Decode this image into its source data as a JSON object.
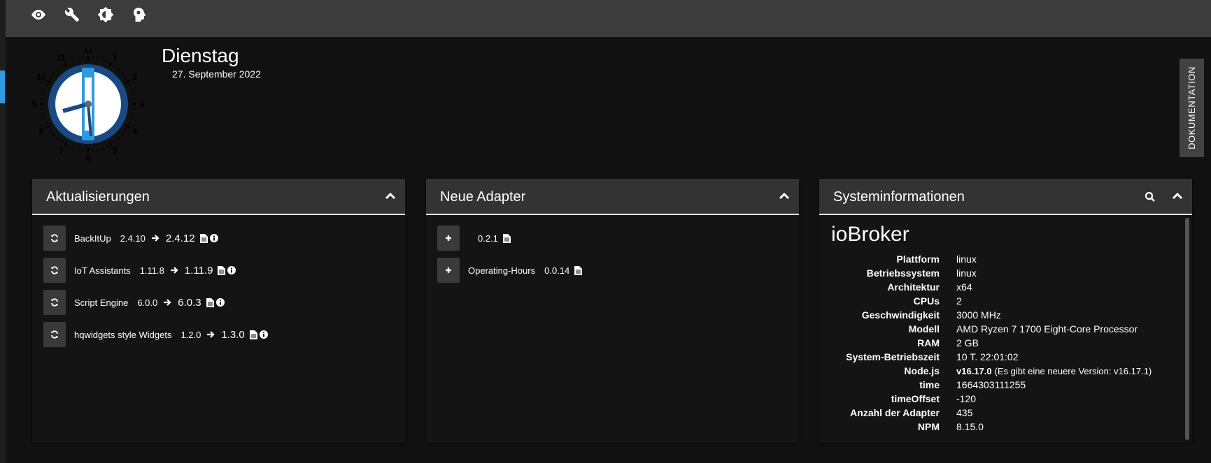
{
  "toolbar": {
    "icons": [
      "eye-icon",
      "wrench-icon",
      "brightness-icon",
      "head-icon"
    ]
  },
  "date": {
    "weekday": "Dienstag",
    "full": "27. September 2022"
  },
  "clock": {
    "numbers": [
      "12",
      "1",
      "2",
      "3",
      "4",
      "5",
      "6",
      "7",
      "8",
      "9",
      "10",
      "11"
    ]
  },
  "doc_tab": {
    "label": "DOKUMENTATION"
  },
  "updates": {
    "title": "Aktualisierungen",
    "items": [
      {
        "name": "BackItUp",
        "old": "2.4.10",
        "new": "2.4.12"
      },
      {
        "name": "IoT Assistants",
        "old": "1.11.8",
        "new": "1.11.9"
      },
      {
        "name": "Script Engine",
        "old": "6.0.0",
        "new": "6.0.3"
      },
      {
        "name": "hqwidgets style Widgets",
        "old": "1.2.0",
        "new": "1.3.0"
      }
    ]
  },
  "new_adapters": {
    "title": "Neue Adapter",
    "items": [
      {
        "name": "",
        "version": "0.2.1"
      },
      {
        "name": "Operating-Hours",
        "version": "0.0.14"
      }
    ]
  },
  "sysinfo": {
    "title": "Systeminformationen",
    "heading": "ioBroker",
    "rows": [
      {
        "label": "Plattform",
        "value": "linux"
      },
      {
        "label": "Betriebssystem",
        "value": "linux"
      },
      {
        "label": "Architektur",
        "value": "x64"
      },
      {
        "label": "CPUs",
        "value": "2"
      },
      {
        "label": "Geschwindigkeit",
        "value": "3000 MHz"
      },
      {
        "label": "Modell",
        "value": "AMD Ryzen 7 1700 Eight-Core Processor"
      },
      {
        "label": "RAM",
        "value": "2 GB"
      },
      {
        "label": "System-Betriebszeit",
        "value": "10 T. 22:01:02"
      },
      {
        "label": "Node.js",
        "value": "v16.17.0",
        "note": "(Es gibt eine neuere Version: v16.17.1)"
      },
      {
        "label": "time",
        "value": "1664303111255"
      },
      {
        "label": "timeOffset",
        "value": "-120"
      },
      {
        "label": "Anzahl der Adapter",
        "value": "435"
      },
      {
        "label": "NPM",
        "value": "8.15.0"
      }
    ]
  },
  "colors": {
    "accent": "#2f9bde",
    "topbar": "#3c3c3c",
    "background": "#111111",
    "clock_face": "#1b4a82"
  }
}
